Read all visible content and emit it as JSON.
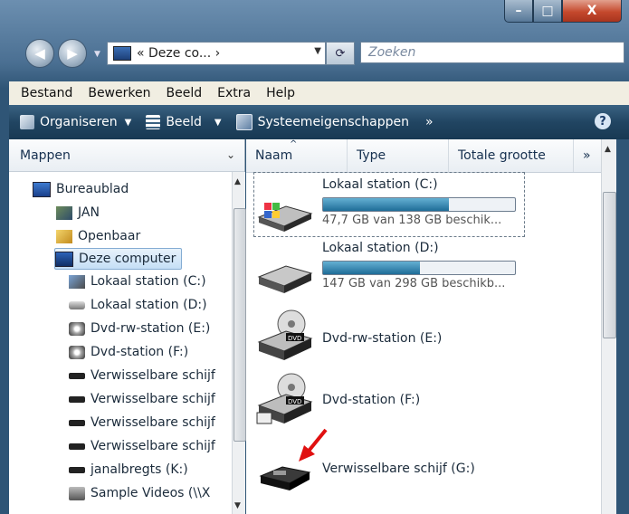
{
  "window": {
    "caption": {
      "minimize": "–",
      "maximize": "□",
      "close": "X"
    }
  },
  "address": {
    "path": "« Deze co... ›",
    "search_placeholder": "Zoeken"
  },
  "menu": [
    "Bestand",
    "Bewerken",
    "Beeld",
    "Extra",
    "Help"
  ],
  "toolbar": {
    "organize": "Organiseren",
    "view": "Beeld",
    "system": "Systeemeigenschappen",
    "more": "»",
    "help": "?"
  },
  "left_pane": {
    "header": "Mappen",
    "items": [
      {
        "label": "Bureaublad",
        "icon": "desktop-icon"
      },
      {
        "label": "JAN",
        "icon": "user-folder-icon"
      },
      {
        "label": "Openbaar",
        "icon": "public-folder-icon"
      },
      {
        "label": "Deze computer",
        "icon": "computer-icon"
      },
      {
        "label": "Lokaal station (C:)",
        "icon": "system-drive-icon"
      },
      {
        "label": "Lokaal station (D:)",
        "icon": "hard-drive-icon"
      },
      {
        "label": "Dvd-rw-station (E:)",
        "icon": "dvd-drive-icon"
      },
      {
        "label": "Dvd-station (F:)",
        "icon": "dvd-drive-icon"
      },
      {
        "label": "Verwisselbare schijf",
        "icon": "removable-drive-icon"
      },
      {
        "label": "Verwisselbare schijf",
        "icon": "removable-drive-icon"
      },
      {
        "label": "Verwisselbare schijf",
        "icon": "removable-drive-icon"
      },
      {
        "label": "Verwisselbare schijf",
        "icon": "removable-drive-icon"
      },
      {
        "label": "janalbregts (K:)",
        "icon": "removable-drive-icon"
      },
      {
        "label": "Sample Videos (\\\\X",
        "icon": "network-drive-icon"
      }
    ]
  },
  "columns": {
    "name": "Naam",
    "type": "Type",
    "total": "Totale grootte",
    "more": "»"
  },
  "drives": [
    {
      "name": "Lokaal station (C:)",
      "space": "47,7 GB van 138 GB beschik...",
      "usage": 0.655,
      "icon": "system-drive-icon"
    },
    {
      "name": "Lokaal station (D:)",
      "space": "147 GB van 298 GB beschikb...",
      "usage": 0.505,
      "icon": "hard-drive-icon"
    },
    {
      "name": "Dvd-rw-station (E:)",
      "icon": "dvd-drive-icon"
    },
    {
      "name": "Dvd-station (F:)",
      "icon": "dvd-drive-icon"
    },
    {
      "name": "Verwisselbare schijf (G:)",
      "icon": "removable-drive-icon"
    }
  ],
  "colors": {
    "toolbar": "#214562",
    "progress": "#1f6d98",
    "arrow": "#e01010"
  }
}
